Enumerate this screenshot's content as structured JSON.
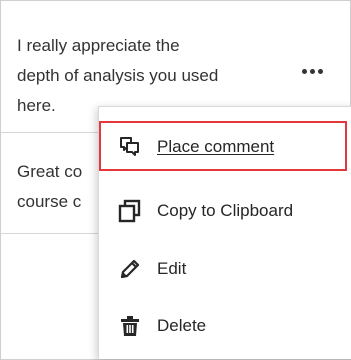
{
  "comments": [
    {
      "text": "I really appreciate the\ndepth of analysis you used\nhere."
    },
    {
      "text": "Great co\ncourse c"
    }
  ],
  "more_button": {
    "icon": "more-horizontal-icon"
  },
  "menu": {
    "items": [
      {
        "label": "Place comment",
        "icon": "comment-icon"
      },
      {
        "label": "Copy to Clipboard",
        "icon": "copy-icon"
      },
      {
        "label": "Edit",
        "icon": "pencil-icon"
      },
      {
        "label": "Delete",
        "icon": "trash-icon"
      }
    ],
    "highlight_color": "#e5383b"
  }
}
